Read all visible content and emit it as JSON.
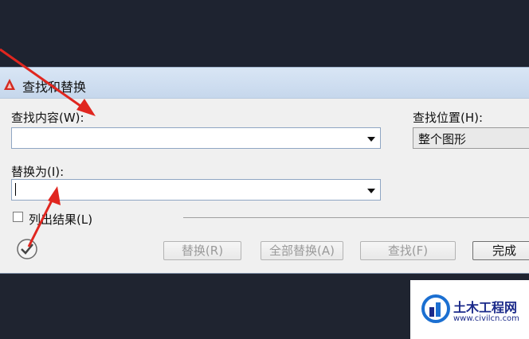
{
  "dialog": {
    "title": "查找和替换",
    "find_label": "查找内容(W):",
    "find_value": "",
    "replace_label": "替换为(I):",
    "replace_value": "",
    "location_label": "查找位置(H):",
    "location_value": "整个图形",
    "list_results_label": "列出结果(L)",
    "list_results_checked": false
  },
  "buttons": {
    "replace": "替换(R)",
    "replace_all": "全部替换(A)",
    "find": "查找(F)",
    "done": "完成"
  },
  "watermark": {
    "name": "土木工程网",
    "url": "www.civilcn.com"
  },
  "colors": {
    "annotation_arrow": "#e0261f",
    "titlebar": "#c6d7ec",
    "brand": "#1b2a8a"
  }
}
